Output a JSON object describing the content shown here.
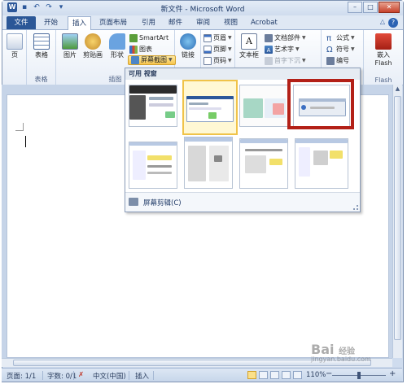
{
  "window": {
    "title": "新文件 - Microsoft Word",
    "quick_access": [
      "save-icon",
      "undo-icon",
      "redo-icon",
      "customize-icon"
    ],
    "controls": [
      "minimize",
      "maximize",
      "close"
    ]
  },
  "tabs": [
    {
      "label": "文件",
      "id": "file"
    },
    {
      "label": "开始",
      "id": "home"
    },
    {
      "label": "插入",
      "id": "insert",
      "active": true
    },
    {
      "label": "页面布局",
      "id": "layout"
    },
    {
      "label": "引用",
      "id": "references"
    },
    {
      "label": "邮件",
      "id": "mailings"
    },
    {
      "label": "审阅",
      "id": "review"
    },
    {
      "label": "视图",
      "id": "view"
    },
    {
      "label": "Acrobat",
      "id": "acrobat"
    }
  ],
  "ribbon": {
    "pages": {
      "label": "页"
    },
    "tables": {
      "label": "表格",
      "group": "表格"
    },
    "illustrations": {
      "group": "插图",
      "picture": "图片",
      "clipart": "剪贴画",
      "shapes": "形状",
      "smartart": "SmartArt",
      "chart": "图表",
      "screenshot": "屏幕截图"
    },
    "links": {
      "label": "链接"
    },
    "header_footer": {
      "header": "页眉",
      "footer": "页脚",
      "page_number": "页码"
    },
    "text": {
      "textbox": "文本框",
      "quickparts": "文档部件",
      "wordart": "艺术字",
      "dropcap": "首字下沉"
    },
    "symbols": {
      "equation": "公式",
      "symbol": "符号",
      "numbering": "编号"
    },
    "flash": {
      "embed": "嵌入",
      "flash": "Flash",
      "group": "Flash"
    }
  },
  "gallery": {
    "header": "可用 视窗",
    "clip_label": "屏幕剪辑(C)",
    "highlighted_index": 2,
    "selected_index": 1
  },
  "status": {
    "page": "页面: 1/1",
    "words": "字数: 0/1",
    "language": "中文(中国)",
    "mode": "插入",
    "zoom": "110%"
  },
  "watermark": {
    "brand": "Bai",
    "sub": "经验",
    "site": "jingyan.baidu.com"
  },
  "colors": {
    "file_tab": "#2b5797",
    "highlight_border": "#b32017",
    "selected_thumb": "#f0c349"
  }
}
